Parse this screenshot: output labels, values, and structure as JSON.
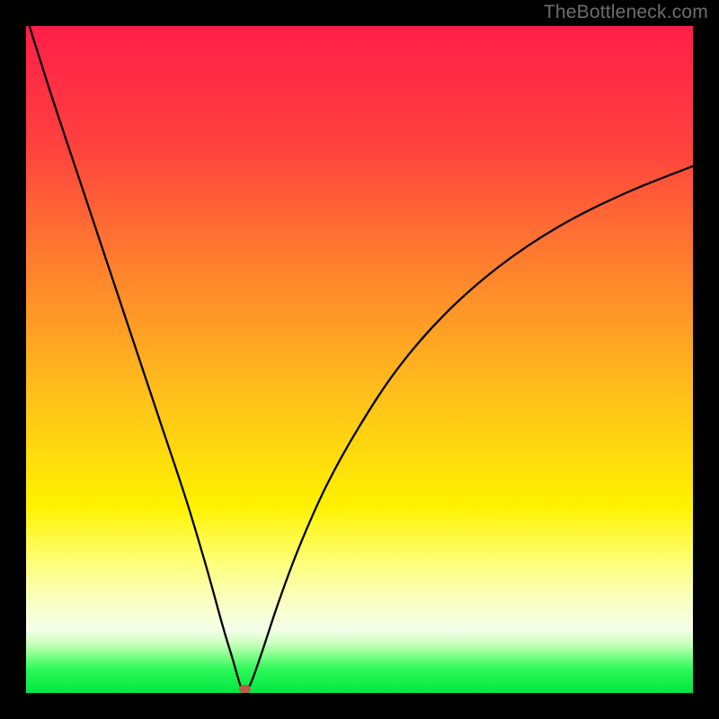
{
  "watermark": "TheBottleneck.com",
  "colors": {
    "black": "#000000",
    "gradient_stops": [
      {
        "offset": 0,
        "color": "#ff1f49"
      },
      {
        "offset": 17,
        "color": "#ff3f3f"
      },
      {
        "offset": 39,
        "color": "#ff8a2b"
      },
      {
        "offset": 56,
        "color": "#ffc21a"
      },
      {
        "offset": 72,
        "color": "#fff200"
      },
      {
        "offset": 80,
        "color": "#fdff72"
      },
      {
        "offset": 86,
        "color": "#fbffc0"
      },
      {
        "offset": 90.5,
        "color": "#f3ffe9"
      },
      {
        "offset": 92.5,
        "color": "#cfffc0"
      },
      {
        "offset": 94.5,
        "color": "#7dff87"
      },
      {
        "offset": 96.5,
        "color": "#2cf75a"
      },
      {
        "offset": 100,
        "color": "#00e840"
      }
    ],
    "curve_stroke": "#000000",
    "vertex_dot": "#bb5a4c"
  },
  "chart_data": {
    "type": "line",
    "title": "",
    "xlabel": "",
    "ylabel": "",
    "x_range": [
      0,
      100
    ],
    "y_range": [
      0,
      100
    ],
    "vertex": {
      "x": 32.8,
      "y": 0.6
    },
    "series": [
      {
        "name": "bottleneck-curve",
        "points": [
          {
            "x": 0.5,
            "y": 100
          },
          {
            "x": 4,
            "y": 89
          },
          {
            "x": 8,
            "y": 77
          },
          {
            "x": 12,
            "y": 65
          },
          {
            "x": 16,
            "y": 53
          },
          {
            "x": 20,
            "y": 41
          },
          {
            "x": 24,
            "y": 29
          },
          {
            "x": 27,
            "y": 19
          },
          {
            "x": 29.5,
            "y": 10
          },
          {
            "x": 31,
            "y": 5
          },
          {
            "x": 31.8,
            "y": 2.2
          },
          {
            "x": 32.3,
            "y": 0.9
          },
          {
            "x": 33.3,
            "y": 0.9
          },
          {
            "x": 34,
            "y": 2.2
          },
          {
            "x": 35.5,
            "y": 6.5
          },
          {
            "x": 38,
            "y": 14
          },
          {
            "x": 41,
            "y": 22
          },
          {
            "x": 45,
            "y": 31
          },
          {
            "x": 50,
            "y": 40
          },
          {
            "x": 56,
            "y": 49
          },
          {
            "x": 63,
            "y": 57
          },
          {
            "x": 71,
            "y": 64
          },
          {
            "x": 80,
            "y": 70
          },
          {
            "x": 90,
            "y": 75
          },
          {
            "x": 100,
            "y": 79
          }
        ]
      }
    ]
  }
}
